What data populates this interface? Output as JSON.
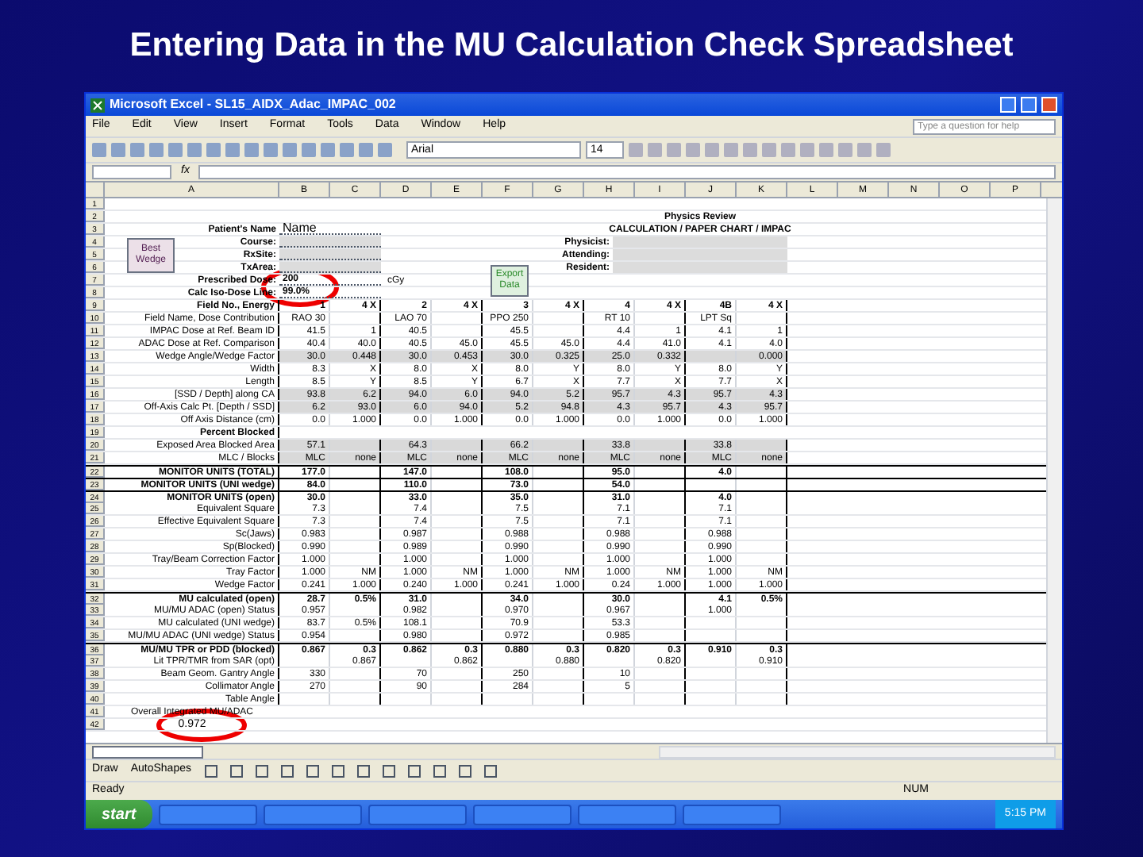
{
  "slide_title": "Entering Data in the MU Calculation Check Spreadsheet",
  "window": {
    "title": "Microsoft Excel - SL15_AIDX_Adac_IMPAC_002"
  },
  "menu": [
    "File",
    "Edit",
    "View",
    "Insert",
    "Format",
    "Tools",
    "Data",
    "Window",
    "Help"
  ],
  "help_box": {
    "placeholder": "Type a question for help"
  },
  "toolbar": {
    "font": "Arial",
    "size": "14"
  },
  "formula_bar": {
    "fx": "fx"
  },
  "columns": [
    "A",
    "B",
    "C",
    "D",
    "E",
    "F",
    "G",
    "H",
    "I",
    "J",
    "K",
    "L",
    "M",
    "N",
    "O",
    "P"
  ],
  "buttons": [
    "Best Wedge",
    "Export Data"
  ],
  "rows": [
    {
      "num": "1",
      "kind": "blank"
    },
    {
      "num": "2",
      "kind": "blank",
      "side": {
        "kind": "heading",
        "text": "Physics Review"
      }
    },
    {
      "num": "3",
      "kind": "field",
      "label": "Patient's Name",
      "value": "Name",
      "side": {
        "kind": "heading",
        "text": "CALCULATION / PAPER CHART / IMPAC"
      }
    },
    {
      "num": "4",
      "kind": "field",
      "label": "Course:",
      "side": {
        "kind": "label",
        "text": "Physicist:"
      }
    },
    {
      "num": "5",
      "kind": "field",
      "label": "RxSite:",
      "side": {
        "kind": "label",
        "text": "Attending:"
      }
    },
    {
      "num": "6",
      "kind": "field",
      "label": "TxArea:",
      "side": {
        "kind": "label",
        "text": "Resident:"
      }
    },
    {
      "num": "7",
      "kind": "field",
      "label": "Prescribed Dose:",
      "value": "200",
      "unit": "cGy"
    },
    {
      "num": "8",
      "kind": "field",
      "label": "Calc Iso-Dose Line:",
      "value": "99.0%"
    },
    {
      "num": "9",
      "kind": "heading",
      "label": "Field No., Energy",
      "cells": [
        "1",
        "4 X",
        "2",
        "4 X",
        "3",
        "4 X",
        "4",
        "4 X",
        "4B",
        "4 X"
      ]
    },
    {
      "num": "10",
      "kind": "data",
      "shaded": false,
      "label": "Field Name, Dose Contribution",
      "cells": [
        "RAO 30",
        "",
        "LAO 70",
        "",
        "PPO 250",
        "",
        "RT 10",
        "",
        "LPT Sq",
        ""
      ]
    },
    {
      "num": "11",
      "kind": "data",
      "shaded": false,
      "label": "IMPAC Dose at Ref. Beam ID",
      "cells": [
        "41.5",
        "1",
        "40.5",
        "",
        "45.5",
        "",
        "4.4",
        "1",
        "4.1",
        "1"
      ]
    },
    {
      "num": "12",
      "kind": "data",
      "shaded": false,
      "label": "ADAC Dose at Ref. Comparison",
      "cells": [
        "40.4",
        "40.0",
        "40.5",
        "45.0",
        "45.5",
        "45.0",
        "4.4",
        "41.0",
        "4.1",
        "4.0"
      ]
    },
    {
      "num": "13",
      "kind": "data",
      "shaded": true,
      "label": "Wedge Angle/Wedge Factor",
      "cells": [
        "30.0",
        "0.448",
        "30.0",
        "0.453",
        "30.0",
        "0.325",
        "25.0",
        "0.332",
        "",
        "0.000"
      ]
    },
    {
      "num": "14",
      "kind": "data",
      "shaded": false,
      "label": "Width",
      "cells": [
        "8.3",
        "X",
        "8.0",
        "X",
        "8.0",
        "Y",
        "8.0",
        "Y",
        "8.0",
        "Y"
      ]
    },
    {
      "num": "15",
      "kind": "data",
      "shaded": false,
      "label": "Length",
      "cells": [
        "8.5",
        "Y",
        "8.5",
        "Y",
        "6.7",
        "X",
        "7.7",
        "X",
        "7.7",
        "X"
      ]
    },
    {
      "num": "16",
      "kind": "data",
      "shaded": true,
      "label": "[SSD / Depth] along CA",
      "cells": [
        "93.8",
        "6.2",
        "94.0",
        "6.0",
        "94.0",
        "5.2",
        "95.7",
        "4.3",
        "95.7",
        "4.3"
      ]
    },
    {
      "num": "17",
      "kind": "data",
      "shaded": true,
      "label": "Off-Axis Calc Pt. [Depth / SSD]",
      "cells": [
        "6.2",
        "93.0",
        "6.0",
        "94.0",
        "5.2",
        "94.8",
        "4.3",
        "95.7",
        "4.3",
        "95.7"
      ]
    },
    {
      "num": "18",
      "kind": "data",
      "shaded": false,
      "label": "Off Axis Distance (cm)",
      "cells": [
        "0.0",
        "1.000",
        "0.0",
        "1.000",
        "0.0",
        "1.000",
        "0.0",
        "1.000",
        "0.0",
        "1.000"
      ]
    },
    {
      "num": "19",
      "kind": "heading",
      "label": "Percent Blocked",
      "cells": []
    },
    {
      "num": "20",
      "kind": "data",
      "shaded": true,
      "label": "Exposed Area Blocked Area",
      "cells": [
        "57.1",
        "",
        "64.3",
        "",
        "66.2",
        "",
        "33.8",
        "",
        "33.8",
        ""
      ]
    },
    {
      "num": "21",
      "kind": "data",
      "shaded": true,
      "label": "MLC / Blocks",
      "cells": [
        "MLC",
        "none",
        "MLC",
        "none",
        "MLC",
        "none",
        "MLC",
        "none",
        "MLC",
        "none"
      ]
    },
    {
      "num": "22",
      "kind": "total",
      "label": "MONITOR UNITS (TOTAL)",
      "cells": [
        "177.0",
        "",
        "147.0",
        "",
        "108.0",
        "",
        "95.0",
        "",
        "4.0",
        ""
      ]
    },
    {
      "num": "23",
      "kind": "total",
      "label": "MONITOR UNITS (UNI wedge)",
      "cells": [
        "84.0",
        "",
        "110.0",
        "",
        "73.0",
        "",
        "54.0",
        "",
        "",
        ""
      ]
    },
    {
      "num": "24",
      "kind": "total",
      "label": "MONITOR UNITS (open)",
      "cells": [
        "30.0",
        "",
        "33.0",
        "",
        "35.0",
        "",
        "31.0",
        "",
        "4.0",
        ""
      ]
    },
    {
      "num": "25",
      "kind": "data",
      "shaded": false,
      "label": "Equivalent Square",
      "cells": [
        "7.3",
        "",
        "7.4",
        "",
        "7.5",
        "",
        "7.1",
        "",
        "7.1",
        ""
      ]
    },
    {
      "num": "26",
      "kind": "data",
      "shaded": false,
      "label": "Effective Equivalent Square",
      "cells": [
        "7.3",
        "",
        "7.4",
        "",
        "7.5",
        "",
        "7.1",
        "",
        "7.1",
        ""
      ]
    },
    {
      "num": "27",
      "kind": "data",
      "shaded": false,
      "label": "Sc(Jaws)",
      "cells": [
        "0.983",
        "",
        "0.987",
        "",
        "0.988",
        "",
        "0.988",
        "",
        "0.988",
        ""
      ]
    },
    {
      "num": "28",
      "kind": "data",
      "shaded": false,
      "label": "Sp(Blocked)",
      "cells": [
        "0.990",
        "",
        "0.989",
        "",
        "0.990",
        "",
        "0.990",
        "",
        "0.990",
        ""
      ]
    },
    {
      "num": "29",
      "kind": "data",
      "shaded": false,
      "label": "Tray/Beam Correction Factor",
      "cells": [
        "1.000",
        "",
        "1.000",
        "",
        "1.000",
        "",
        "1.000",
        "",
        "1.000",
        ""
      ]
    },
    {
      "num": "30",
      "kind": "data",
      "shaded": false,
      "label": "Tray Factor",
      "cells": [
        "1.000",
        "NM",
        "1.000",
        "NM",
        "1.000",
        "NM",
        "1.000",
        "NM",
        "1.000",
        "NM"
      ]
    },
    {
      "num": "31",
      "kind": "data",
      "shaded": false,
      "label": "Wedge Factor",
      "cells": [
        "0.241",
        "1.000",
        "0.240",
        "1.000",
        "0.241",
        "1.000",
        "0.24",
        "1.000",
        "1.000",
        "1.000"
      ]
    },
    {
      "num": "32",
      "kind": "total",
      "label": "MU calculated (open)",
      "cells": [
        "28.7",
        "0.5%",
        "31.0",
        "",
        "34.0",
        "",
        "30.0",
        "",
        "4.1",
        "0.5%"
      ]
    },
    {
      "num": "33",
      "kind": "data",
      "shaded": false,
      "label": "MU/MU ADAC (open) Status",
      "cells": [
        "0.957",
        "",
        "0.982",
        "",
        "0.970",
        "",
        "0.967",
        "",
        "1.000",
        ""
      ]
    },
    {
      "num": "34",
      "kind": "data",
      "shaded": false,
      "label": "MU calculated (UNI wedge)",
      "cells": [
        "83.7",
        "0.5%",
        "108.1",
        "",
        "70.9",
        "",
        "53.3",
        "",
        "",
        ""
      ]
    },
    {
      "num": "35",
      "kind": "data",
      "shaded": false,
      "label": "MU/MU ADAC (UNI wedge) Status",
      "cells": [
        "0.954",
        "",
        "0.980",
        "",
        "0.972",
        "",
        "0.985",
        "",
        "",
        ""
      ]
    },
    {
      "num": "36",
      "kind": "total",
      "label": "MU/MU TPR or PDD (blocked)",
      "cells": [
        "0.867",
        "0.3",
        "0.862",
        "0.3",
        "0.880",
        "0.3",
        "0.820",
        "0.3",
        "0.910",
        "0.3"
      ]
    },
    {
      "num": "37",
      "kind": "data",
      "shaded": false,
      "label": "Lit TPR/TMR from SAR (opt)",
      "cells": [
        "",
        "0.867",
        "",
        "0.862",
        "",
        "0.880",
        "",
        "0.820",
        "",
        "0.910"
      ]
    },
    {
      "num": "38",
      "kind": "data",
      "shaded": false,
      "label": "Beam Geom. Gantry Angle",
      "cells": [
        "330",
        "",
        "70",
        "",
        "250",
        "",
        "10",
        "",
        "",
        ""
      ]
    },
    {
      "num": "39",
      "kind": "data",
      "shaded": false,
      "label": "Collimator Angle",
      "cells": [
        "270",
        "",
        "90",
        "",
        "284",
        "",
        "5",
        "",
        "",
        ""
      ]
    },
    {
      "num": "40",
      "kind": "data",
      "shaded": false,
      "label": "Table Angle",
      "cells": [
        "",
        "",
        "",
        "",
        "",
        "",
        "",
        "",
        "",
        ""
      ]
    },
    {
      "num": "41",
      "kind": "summary",
      "label": "Overall Integrated MU/ADAC"
    },
    {
      "num": "42",
      "kind": "summary",
      "label": "0.972"
    }
  ],
  "draw_toolbar": [
    "Draw",
    "AutoShapes"
  ],
  "status_bar": {
    "left": "Ready",
    "right": "NUM"
  },
  "taskbar": {
    "start": "start",
    "clock": "5:15 PM"
  }
}
